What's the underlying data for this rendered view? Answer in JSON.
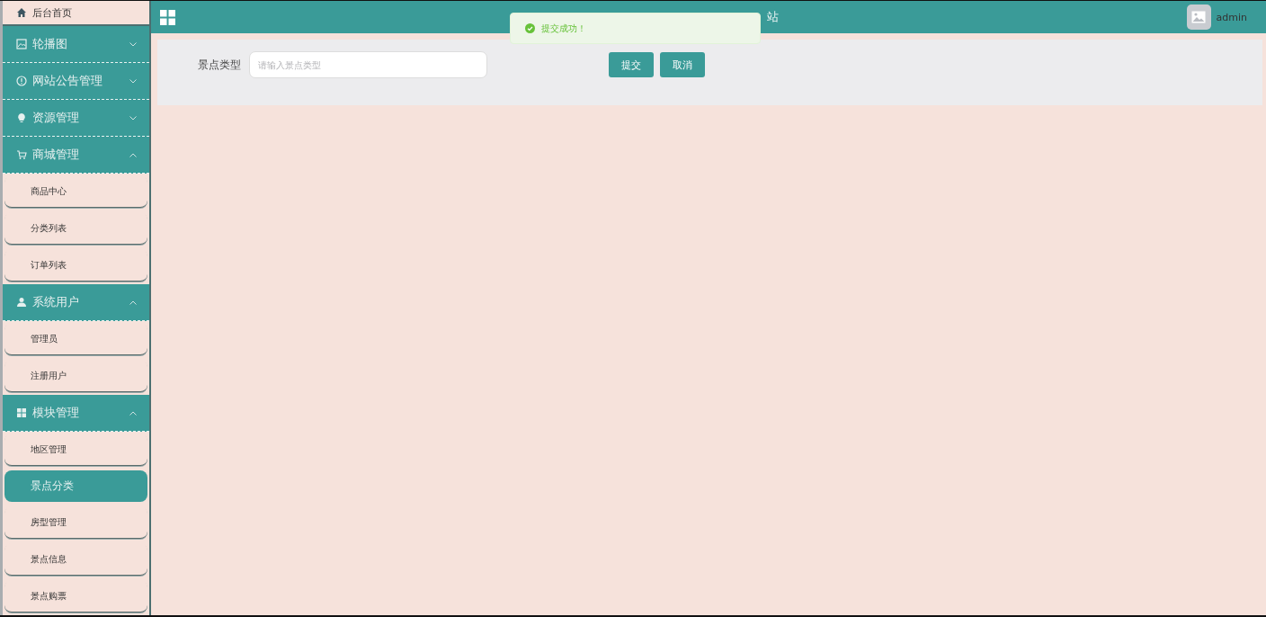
{
  "sidebar": {
    "items": [
      {
        "kind": "home",
        "label": "后台首页"
      },
      {
        "kind": "group",
        "label": "轮播图",
        "expanded": false
      },
      {
        "kind": "group",
        "label": "网站公告管理",
        "expanded": false
      },
      {
        "kind": "group",
        "label": "资源管理",
        "expanded": false
      },
      {
        "kind": "group",
        "label": "商城管理",
        "expanded": true,
        "children": [
          {
            "label": "商品中心",
            "selected": false
          },
          {
            "label": "分类列表",
            "selected": false
          },
          {
            "label": "订单列表",
            "selected": false
          }
        ]
      },
      {
        "kind": "group",
        "label": "系统用户",
        "expanded": true,
        "children": [
          {
            "label": "管理员",
            "selected": false
          },
          {
            "label": "注册用户",
            "selected": false
          }
        ]
      },
      {
        "kind": "group",
        "label": "模块管理",
        "expanded": true,
        "children": [
          {
            "label": "地区管理",
            "selected": false
          },
          {
            "label": "景点分类",
            "selected": true
          },
          {
            "label": "房型管理",
            "selected": false
          },
          {
            "label": "景点信息",
            "selected": false
          },
          {
            "label": "景点购票",
            "selected": false
          }
        ]
      }
    ]
  },
  "header": {
    "title": "站",
    "user": "admin"
  },
  "form": {
    "field": {
      "label": "景点类型",
      "placeholder": "请输入景点类型"
    },
    "buttons": [
      "提交",
      "取消"
    ]
  },
  "toast": {
    "kind": "success",
    "text": "提交成功！"
  }
}
